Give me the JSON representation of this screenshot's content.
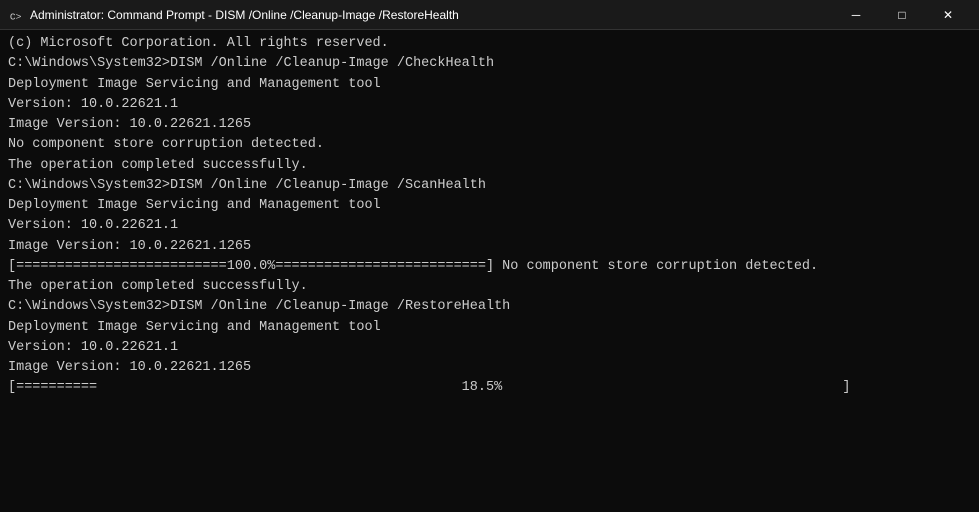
{
  "titleBar": {
    "title": "Administrator: Command Prompt - DISM /Online /Cleanup-Image /RestoreHealth",
    "icon": "cmd-icon",
    "minimizeLabel": "─",
    "maximizeLabel": "□",
    "closeLabel": "✕"
  },
  "terminal": {
    "lines": [
      {
        "text": "(c) Microsoft Corporation. All rights reserved.",
        "type": "normal"
      },
      {
        "text": "",
        "type": "normal"
      },
      {
        "text": "C:\\Windows\\System32>DISM /Online /Cleanup-Image /CheckHealth",
        "type": "normal"
      },
      {
        "text": "",
        "type": "normal"
      },
      {
        "text": "Deployment Image Servicing and Management tool",
        "type": "normal"
      },
      {
        "text": "Version: 10.0.22621.1",
        "type": "normal"
      },
      {
        "text": "",
        "type": "normal"
      },
      {
        "text": "Image Version: 10.0.22621.1265",
        "type": "normal"
      },
      {
        "text": "",
        "type": "normal"
      },
      {
        "text": "No component store corruption detected.",
        "type": "normal"
      },
      {
        "text": "The operation completed successfully.",
        "type": "normal"
      },
      {
        "text": "",
        "type": "normal"
      },
      {
        "text": "C:\\Windows\\System32>DISM /Online /Cleanup-Image /ScanHealth",
        "type": "normal"
      },
      {
        "text": "",
        "type": "normal"
      },
      {
        "text": "Deployment Image Servicing and Management tool",
        "type": "normal"
      },
      {
        "text": "Version: 10.0.22621.1",
        "type": "normal"
      },
      {
        "text": "",
        "type": "normal"
      },
      {
        "text": "Image Version: 10.0.22621.1265",
        "type": "normal"
      },
      {
        "text": "",
        "type": "normal"
      },
      {
        "text": "[==========================100.0%==========================] No component store corruption detected.",
        "type": "normal"
      },
      {
        "text": "The operation completed successfully.",
        "type": "normal"
      },
      {
        "text": "",
        "type": "normal"
      },
      {
        "text": "C:\\Windows\\System32>DISM /Online /Cleanup-Image /RestoreHealth",
        "type": "normal"
      },
      {
        "text": "",
        "type": "normal"
      },
      {
        "text": "Deployment Image Servicing and Management tool",
        "type": "normal"
      },
      {
        "text": "Version: 10.0.22621.1",
        "type": "normal"
      },
      {
        "text": "",
        "type": "normal"
      },
      {
        "text": "Image Version: 10.0.22621.1265",
        "type": "normal"
      },
      {
        "text": "",
        "type": "normal"
      },
      {
        "text": "[==========                                             18.5%                                          ]",
        "type": "progress"
      }
    ]
  }
}
